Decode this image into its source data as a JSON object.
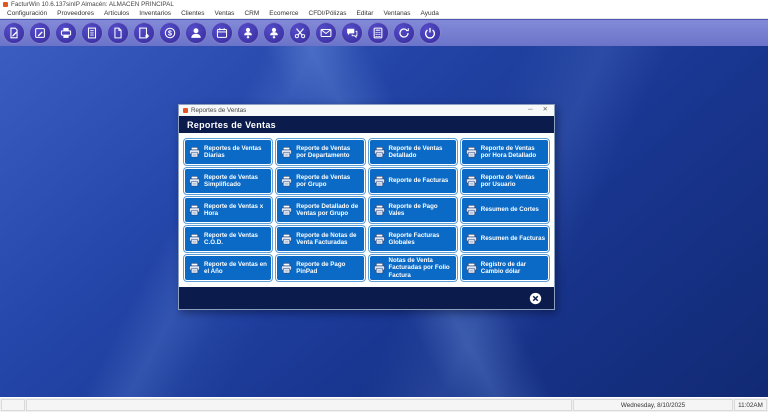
{
  "window": {
    "title": "FacturWin 10.6.137sinIP Almacén: ALMACEN PRINCIPAL"
  },
  "menu_bar": {
    "items": [
      "Configuración",
      "Proveedores",
      "Artículos",
      "Inventarios",
      "Clientes",
      "Ventas",
      "CRM",
      "Ecomerce",
      "CFDI/Pólizas",
      "Editar",
      "Ventanas",
      "Ayuda"
    ]
  },
  "toolbar": {
    "icons": [
      {
        "name": "document-edit-icon",
        "symbol": "doc-edit"
      },
      {
        "name": "note-edit-icon",
        "symbol": "note-edit"
      },
      {
        "name": "cash-register-icon",
        "symbol": "register"
      },
      {
        "name": "document-report-icon",
        "symbol": "doc-lines"
      },
      {
        "name": "document-icon",
        "symbol": "doc"
      },
      {
        "name": "document-add-icon",
        "symbol": "doc-add"
      },
      {
        "name": "money-coin-icon",
        "symbol": "coins"
      },
      {
        "name": "customer-icon",
        "symbol": "user"
      },
      {
        "name": "calendar-icon",
        "symbol": "calendar"
      },
      {
        "name": "user-import-icon",
        "symbol": "user-down"
      },
      {
        "name": "user-import-alt-icon",
        "symbol": "user-down"
      },
      {
        "name": "scissors-icon",
        "symbol": "scissors"
      },
      {
        "name": "email-icon",
        "symbol": "mail"
      },
      {
        "name": "chat-icon",
        "symbol": "chat"
      },
      {
        "name": "calculator-icon",
        "symbol": "calc"
      },
      {
        "name": "sync-icon",
        "symbol": "sync"
      },
      {
        "name": "power-icon",
        "symbol": "power"
      }
    ]
  },
  "dialog": {
    "title": "Reportes  de Ventas",
    "header": "Reportes  de Ventas",
    "minimize_glyph": "─",
    "close_glyph": "✕",
    "buttons": [
      "Reportes de Ventas Diarias",
      "Reporte de Ventas por Departamento",
      "Reporte de Ventas Detallado",
      "Reporte de Ventas por Hora Detallado",
      "Reporte de Ventas Simplificado",
      "Reporte de Ventas por Grupo",
      "Reporte de Facturas",
      "Reporte de Ventas por Usuario",
      "Reporte de Ventas x Hora",
      "Reporte Detallado de Ventas por Grupo",
      "Reporte de Pago Vales",
      "Resumen de Cortes",
      "Reporte de Ventas C.O.D.",
      "Reporte de Notas de Venta Facturadas",
      "Reporte Facturas Globales",
      "Resumen de Facturas",
      "Reporte de Ventas en el Año",
      "Reporte de Pago PinPad",
      "Notas de Venta Facturadas por Folio Factura",
      "Registro de dar Cambio dólar"
    ]
  },
  "status_bar": {
    "date": "Wednesday, 8/10/2025",
    "time": "11:02AM"
  },
  "colors": {
    "button_blue": "#0a6ac6",
    "header_navy": "#0b1b4b",
    "toolbar_icon_purple": "#3d35a8",
    "toolbar_strip": "#7680d1",
    "desktop_blue": "#2547ab",
    "app_icon_orange": "#e2571f"
  }
}
